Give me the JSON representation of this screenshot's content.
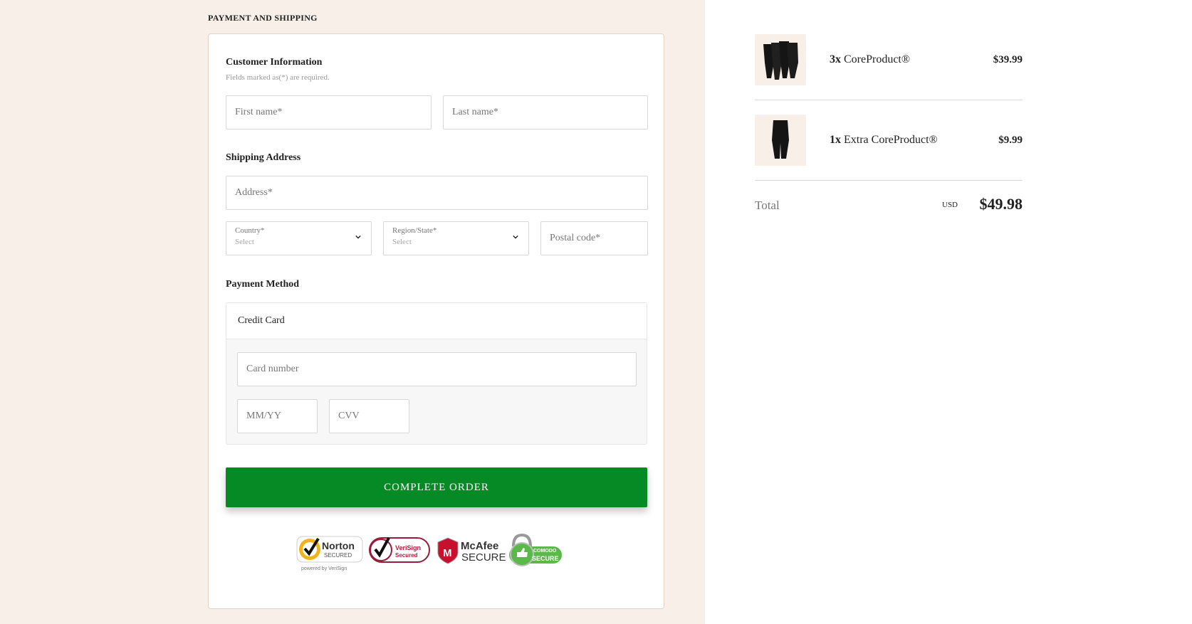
{
  "checkout": {
    "section_title": "PAYMENT AND SHIPPING",
    "customer_info": {
      "heading": "Customer Information",
      "note": "Fields marked as(*) are required.",
      "first_name_placeholder": "First name*",
      "last_name_placeholder": "Last name*"
    },
    "shipping": {
      "heading": "Shipping Address",
      "address_placeholder": "Address*",
      "country_label": "Country*",
      "country_value": "Select",
      "region_label": "Region/State*",
      "region_value": "Select",
      "postal_placeholder": "Postal code*"
    },
    "payment": {
      "heading": "Payment Method",
      "method_label": "Credit Card",
      "card_number_placeholder": "Card number",
      "expiry_placeholder": "MM/YY",
      "cvv_placeholder": "CVV"
    },
    "complete_button": "COMPLETE ORDER",
    "trust_badges": {
      "norton_name": "Norton",
      "norton_sub": "SECURED",
      "norton_powered": "powered by VeriSign",
      "verisign_name": "VeriSign",
      "verisign_sub": "Secured",
      "mcafee_name": "McAfee",
      "mcafee_sub": "SECURE",
      "comodo_name": "COMODO",
      "comodo_sub": "SECURE"
    }
  },
  "summary": {
    "items": [
      {
        "qty": "3x",
        "name": "CoreProduct®",
        "price": "$39.99"
      },
      {
        "qty": "1x",
        "name": "Extra CoreProduct®",
        "price": "$9.99"
      }
    ],
    "total_label": "Total",
    "currency": "USD",
    "total_value": "$49.98"
  },
  "colors": {
    "page_bg": "#f8efe8",
    "button_green": "#058a25",
    "border": "#d8d8d8"
  }
}
